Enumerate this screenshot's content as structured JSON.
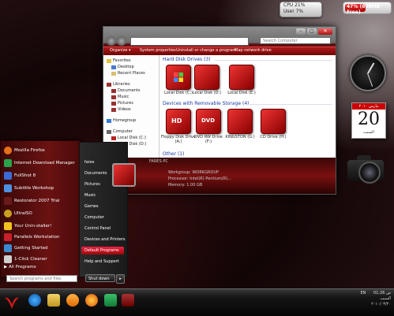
{
  "gadgets": {
    "cpu_label": "CPU 21%",
    "user_label": "User 7%",
    "ram_label": "47% (808MB Free)",
    "ram_percent": 47,
    "calendar": {
      "month": "مارس ٢٠١٠",
      "day": "20",
      "weekday": "السبت"
    }
  },
  "explorer": {
    "search_placeholder": "Search Computer",
    "toolbar": {
      "organize": "Organize ▾",
      "system_properties": "System properties",
      "uninstall": "Uninstall or change a program",
      "map_drive": "Map network drive"
    },
    "nav": [
      {
        "label": "Favorites"
      },
      {
        "label": "Desktop"
      },
      {
        "label": "Recent Places"
      },
      {
        "label": "Libraries"
      },
      {
        "label": "Documents"
      },
      {
        "label": "Music"
      },
      {
        "label": "Pictures"
      },
      {
        "label": "Videos"
      },
      {
        "label": "Homegroup"
      },
      {
        "label": "Computer"
      },
      {
        "label": "Local Disk (C:)"
      },
      {
        "label": "Local Disk (D:)"
      }
    ],
    "groups": {
      "hdd": "Hard Disk Drives (3)",
      "removable": "Devices with Removable Storage (4)",
      "other": "Other (1)"
    },
    "drives": [
      {
        "label": "Local Disk (C:)"
      },
      {
        "label": "Local Disk (D:)"
      },
      {
        "label": "Local Disk (E:)"
      }
    ],
    "removable": [
      {
        "label": "Floppy Disk Drive (A:)"
      },
      {
        "label": "DVD RW Drive (F:)"
      },
      {
        "label": "KINGSTON (G:)"
      },
      {
        "label": "CD Drive (H:)"
      }
    ],
    "details": {
      "name": "FARES-PC",
      "line1": "Workgroup: WORKGROUP",
      "line2": "Processor: Intel(R) Pentium(R)...",
      "line3": "Memory: 1.00 GB"
    }
  },
  "startmenu": {
    "programs": [
      {
        "label": "Mozilla Firefox",
        "color": "#e8701a"
      },
      {
        "label": "Internet Download Manager",
        "color": "#2aa14a"
      },
      {
        "label": "FullShot 8",
        "color": "#3a6ad6"
      },
      {
        "label": "Subtitle Workshop",
        "color": "#4e8fe0"
      },
      {
        "label": "Restorator 2007 Trial",
        "color": "#6a1a1a"
      },
      {
        "label": "UltraISO",
        "color": "#c8a020"
      },
      {
        "label": "Your Unin-staller!",
        "color": "#f2c21c"
      },
      {
        "label": "Parallels Workstation",
        "color": "#c8202a"
      },
      {
        "label": "Getting Started",
        "color": "#3a8ad0"
      },
      {
        "label": "1-Click Cleaner",
        "color": "#cfcfcf"
      }
    ],
    "all_programs": "▶  All Programs",
    "search_placeholder": "Search programs and files",
    "right_items": [
      {
        "label": "fares"
      },
      {
        "label": "Documents"
      },
      {
        "label": "Pictures"
      },
      {
        "label": "Music"
      },
      {
        "label": "Games"
      },
      {
        "label": "Computer"
      },
      {
        "label": "Control Panel"
      },
      {
        "label": "Devices and Printers"
      },
      {
        "label": "Default Programs"
      },
      {
        "label": "Help and Support"
      }
    ],
    "shutdown": "Shut down",
    "shutdown_arrow": "▸"
  },
  "taskbar": {
    "lang": "EN",
    "time": "ص 01:26",
    "day": "السبت",
    "date": "٢٠١٠/٠٣/٢٠"
  }
}
